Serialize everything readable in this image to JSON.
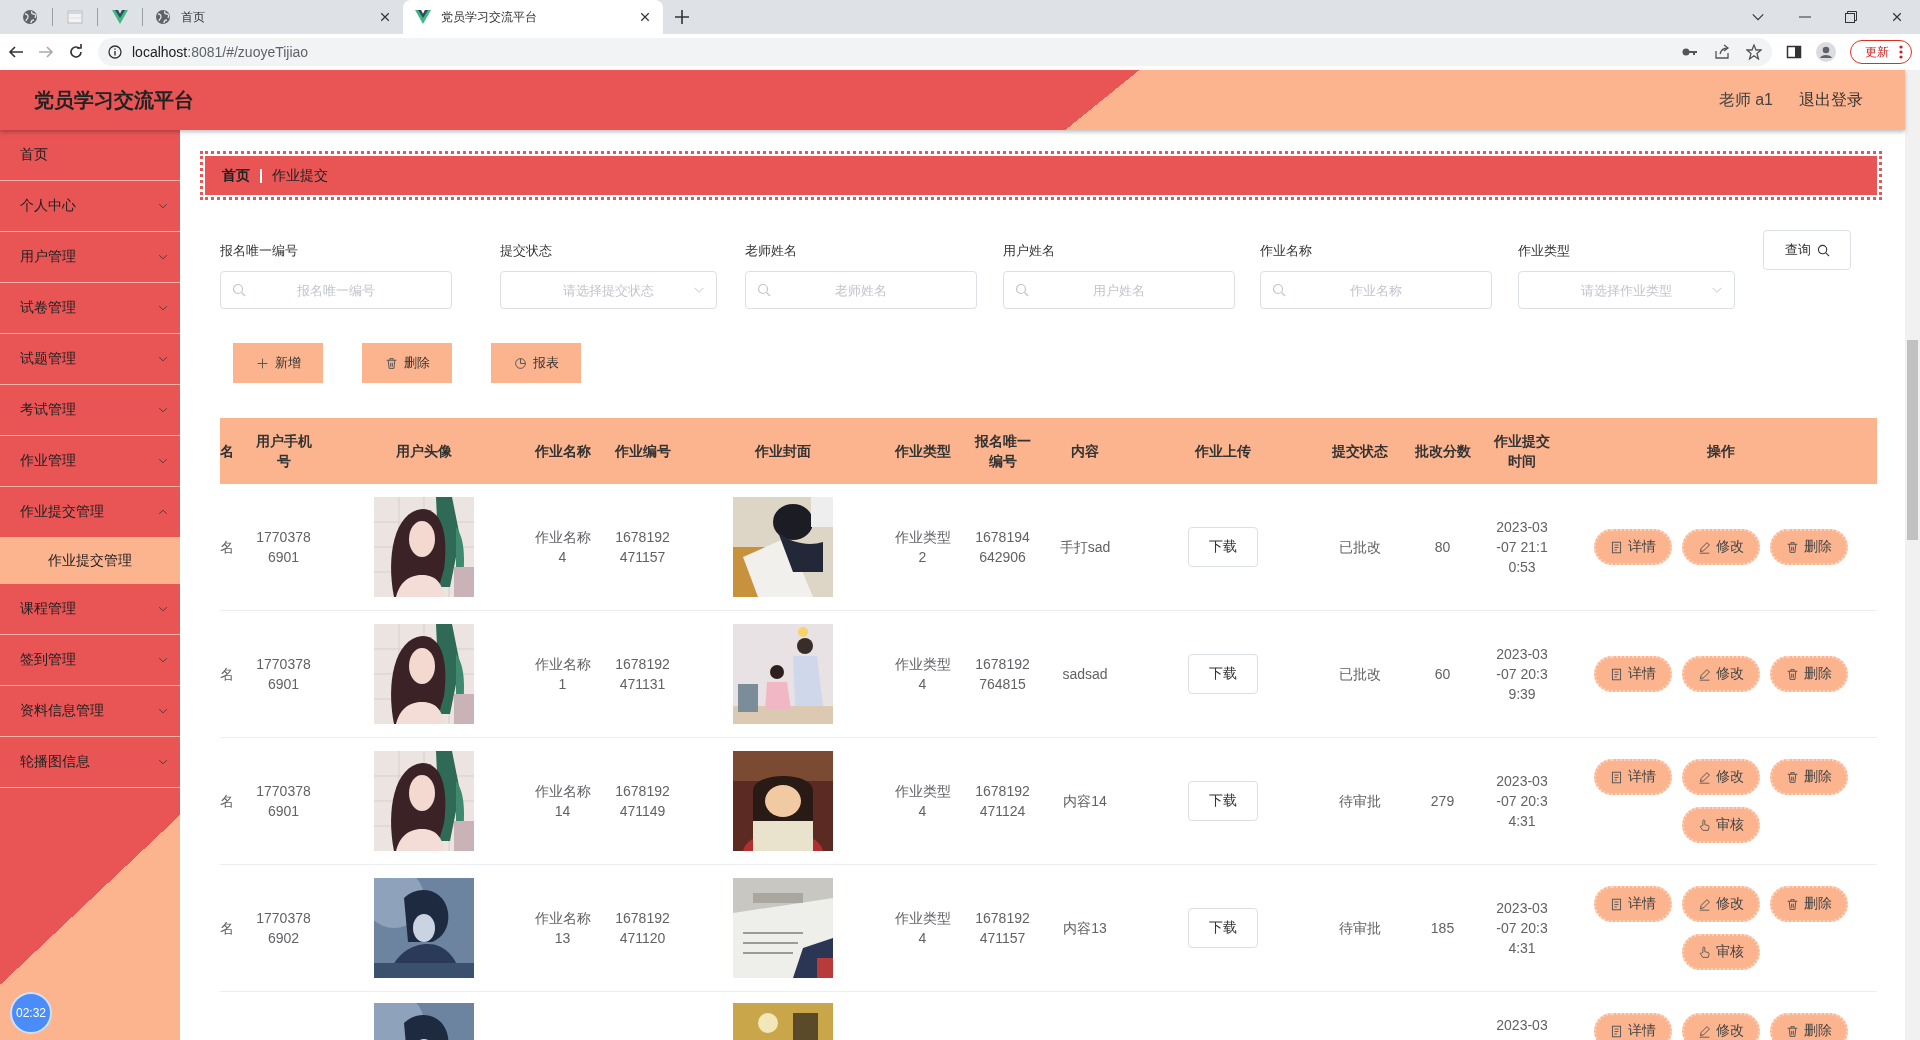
{
  "browser": {
    "tabs": [
      {
        "kind": "globe",
        "selected": false
      },
      {
        "kind": "page",
        "selected": false
      },
      {
        "kind": "vue",
        "selected": false
      },
      {
        "kind": "globe",
        "title": "首页",
        "selected": false
      },
      {
        "kind": "vue",
        "title": "党员学习交流平台",
        "selected": true
      }
    ],
    "url_host": "localhost",
    "url_path": ":8081/#/zuoyeTijiao",
    "update_button": "更新"
  },
  "header": {
    "title": "党员学习交流平台",
    "user": "老师 a1",
    "logout": "退出登录"
  },
  "sidebar": {
    "items": [
      {
        "label": "首页",
        "kind": "link"
      },
      {
        "label": "个人中心",
        "kind": "submenu",
        "expanded": false
      },
      {
        "label": "用户管理",
        "kind": "submenu",
        "expanded": false
      },
      {
        "label": "试卷管理",
        "kind": "submenu",
        "expanded": false
      },
      {
        "label": "试题管理",
        "kind": "submenu",
        "expanded": false
      },
      {
        "label": "考试管理",
        "kind": "submenu",
        "expanded": false
      },
      {
        "label": "作业管理",
        "kind": "submenu",
        "expanded": false
      },
      {
        "label": "作业提交管理",
        "kind": "submenu",
        "expanded": true,
        "children": [
          {
            "label": "作业提交管理",
            "selected": true
          }
        ]
      },
      {
        "label": "课程管理",
        "kind": "submenu",
        "expanded": false
      },
      {
        "label": "签到管理",
        "kind": "submenu",
        "expanded": false
      },
      {
        "label": "资料信息管理",
        "kind": "submenu",
        "expanded": false
      },
      {
        "label": "轮播图信息",
        "kind": "submenu",
        "expanded": false
      }
    ]
  },
  "breadcrumb": [
    "首页",
    "作业提交"
  ],
  "search": {
    "fields": [
      {
        "label": "报名唯一编号",
        "kind": "input",
        "placeholder": "报名唯一编号"
      },
      {
        "label": "提交状态",
        "kind": "select",
        "placeholder": "请选择提交状态"
      },
      {
        "label": "老师姓名",
        "kind": "input",
        "placeholder": "老师姓名"
      },
      {
        "label": "用户姓名",
        "kind": "input",
        "placeholder": "用户姓名"
      },
      {
        "label": "作业名称",
        "kind": "input",
        "placeholder": "作业名称"
      },
      {
        "label": "作业类型",
        "kind": "select",
        "placeholder": "请选择作业类型"
      }
    ],
    "query_button": "查询"
  },
  "toolbar": [
    {
      "kind": "add",
      "label": "新增"
    },
    {
      "kind": "delete",
      "label": "删除"
    },
    {
      "kind": "report",
      "label": "报表"
    }
  ],
  "table": {
    "columns": [
      "名",
      "用户手机号",
      "用户头像",
      "作业名称",
      "作业编号",
      "作业封面",
      "作业类型",
      "报名唯一编号",
      "内容",
      "作业上传",
      "提交状态",
      "批改分数",
      "作业提交时间",
      "操作"
    ],
    "rows": [
      {
        "name": "名",
        "phone": "17703786901",
        "avatar": {
          "kind": "picture"
        },
        "work_name": "作业名称4",
        "work_no": "1678192471157",
        "cover": {
          "kind": "picture"
        },
        "work_type": "作业类型2",
        "signup_no": "1678194642906",
        "content": "手打sad",
        "upload": "下载",
        "status": "已批改",
        "score": "80",
        "time": "2023-03-07 21:10:53",
        "actions": [
          {
            "kind": "detail",
            "label": "详情"
          },
          {
            "kind": "edit",
            "label": "修改"
          },
          {
            "kind": "delete",
            "label": "删除"
          }
        ]
      },
      {
        "name": "名",
        "phone": "17703786901",
        "avatar": {
          "kind": "picture"
        },
        "work_name": "作业名称1",
        "work_no": "1678192471131",
        "cover": {
          "kind": "picture"
        },
        "work_type": "作业类型4",
        "signup_no": "1678192764815",
        "content": "sadsad",
        "upload": "下载",
        "status": "已批改",
        "score": "60",
        "time": "2023-03-07 20:39:39",
        "actions": [
          {
            "kind": "detail",
            "label": "详情"
          },
          {
            "kind": "edit",
            "label": "修改"
          },
          {
            "kind": "delete",
            "label": "删除"
          }
        ]
      },
      {
        "name": "名",
        "phone": "17703786901",
        "avatar": {
          "kind": "picture"
        },
        "work_name": "作业名称14",
        "work_no": "1678192471149",
        "cover": {
          "kind": "picture"
        },
        "work_type": "作业类型4",
        "signup_no": "1678192471124",
        "content": "内容14",
        "upload": "下载",
        "status": "待审批",
        "score": "279",
        "time": "2023-03-07 20:34:31",
        "actions": [
          {
            "kind": "detail",
            "label": "详情"
          },
          {
            "kind": "edit",
            "label": "修改"
          },
          {
            "kind": "delete",
            "label": "删除"
          },
          {
            "kind": "review",
            "label": "审核"
          }
        ]
      },
      {
        "name": "名",
        "phone": "17703786902",
        "avatar": {
          "kind": "picture"
        },
        "work_name": "作业名称13",
        "work_no": "1678192471120",
        "cover": {
          "kind": "picture"
        },
        "work_type": "作业类型4",
        "signup_no": "1678192471157",
        "content": "内容13",
        "upload": "下载",
        "status": "待审批",
        "score": "185",
        "time": "2023-03-07 20:34:31",
        "actions": [
          {
            "kind": "detail",
            "label": "详情"
          },
          {
            "kind": "edit",
            "label": "修改"
          },
          {
            "kind": "delete",
            "label": "删除"
          },
          {
            "kind": "review",
            "label": "审核"
          }
        ]
      },
      {
        "avatar": {
          "kind": "picture"
        },
        "cover": {
          "kind": "picture"
        },
        "time": "2023-03",
        "actions": [
          {
            "kind": "detail",
            "label": "详情"
          },
          {
            "kind": "edit",
            "label": "修改"
          },
          {
            "kind": "delete",
            "label": "删除"
          }
        ]
      }
    ]
  },
  "clock": "02:32"
}
